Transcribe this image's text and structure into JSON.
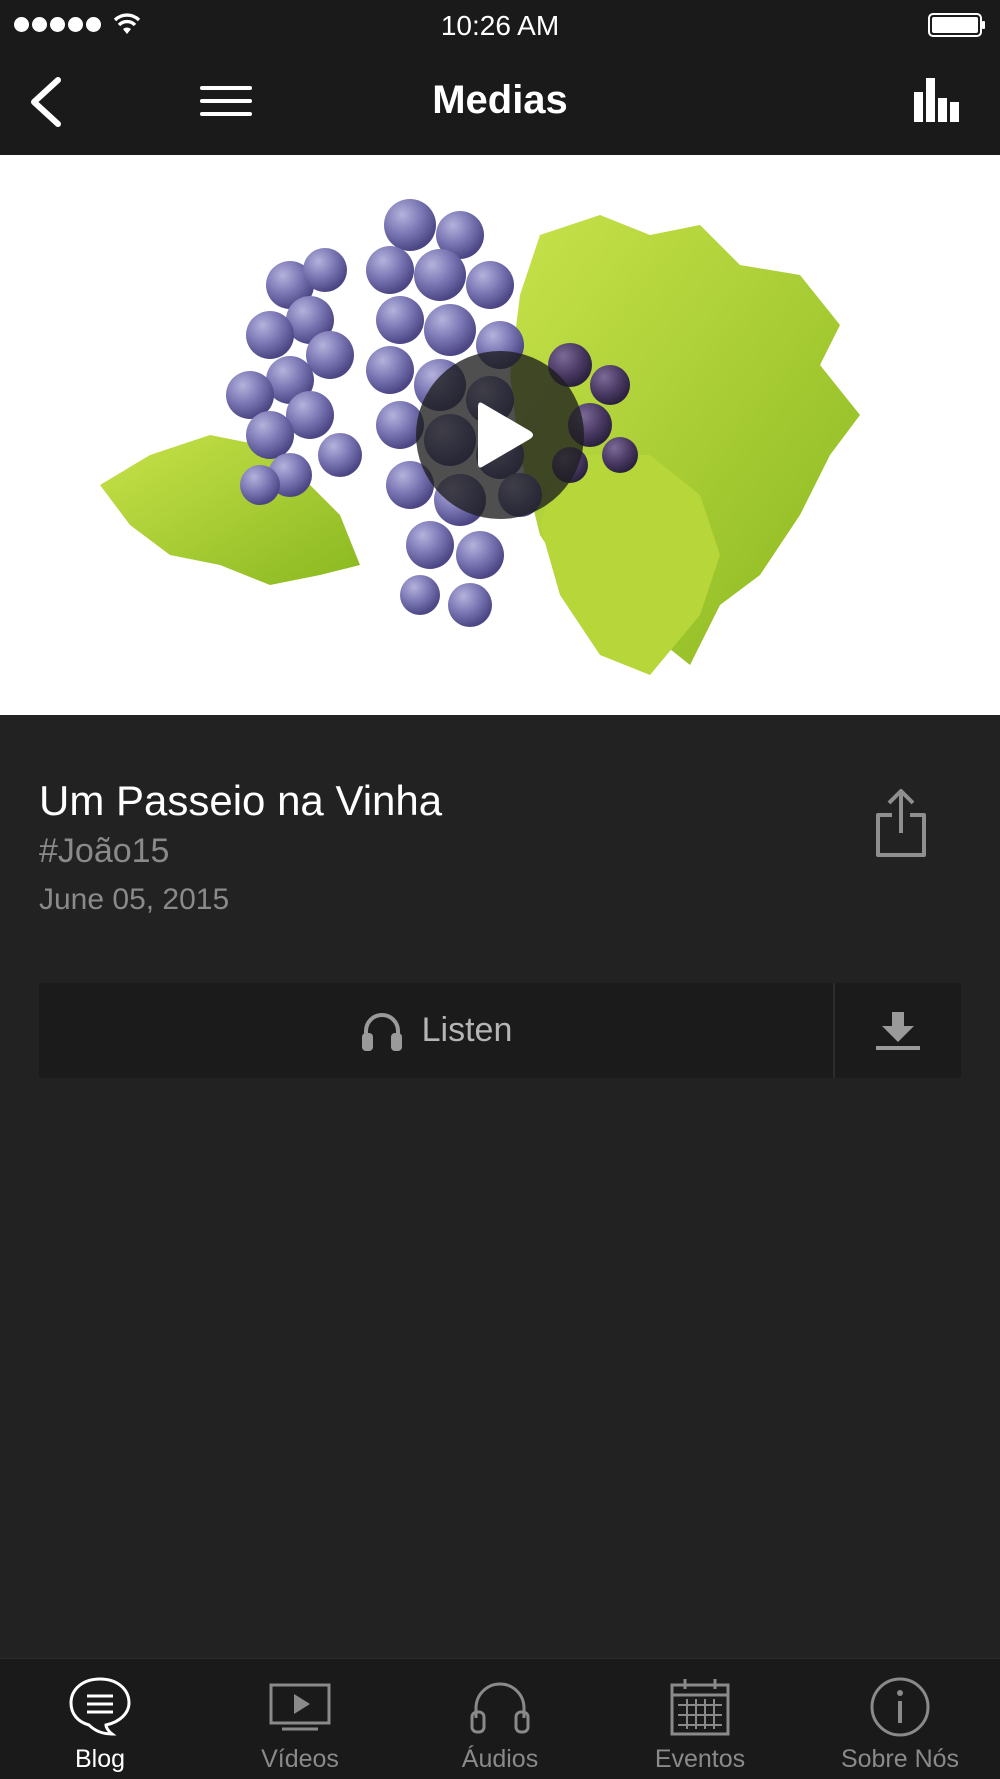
{
  "status_bar": {
    "time": "10:26 AM",
    "signal_icon": "signal-dots-icon",
    "wifi_icon": "wifi-icon",
    "battery_icon": "battery-icon"
  },
  "nav": {
    "title": "Medias",
    "back_icon": "chevron-left-icon",
    "menu_icon": "hamburger-menu-icon",
    "stats_icon": "bar-chart-icon"
  },
  "media": {
    "image_subject": "grapes-image",
    "play_icon": "play-icon"
  },
  "details": {
    "title": "Um Passeio na Vinha",
    "tag": "#João15",
    "date": "June 05, 2015",
    "share_icon": "share-icon"
  },
  "actions": {
    "listen_label": "Listen",
    "listen_icon": "headphones-icon",
    "download_icon": "download-icon"
  },
  "tabs": [
    {
      "label": "Blog",
      "icon": "chat-bubble-icon",
      "active": true
    },
    {
      "label": "Vídeos",
      "icon": "video-player-icon",
      "active": false
    },
    {
      "label": "Áudios",
      "icon": "headphones-icon",
      "active": false
    },
    {
      "label": "Eventos",
      "icon": "calendar-icon",
      "active": false
    },
    {
      "label": "Sobre Nós",
      "icon": "info-icon",
      "active": false
    }
  ],
  "colors": {
    "background": "#222222",
    "bar": "#1a1a1a",
    "muted_text": "#8a8a8a",
    "active_tab": "#ffffff"
  }
}
